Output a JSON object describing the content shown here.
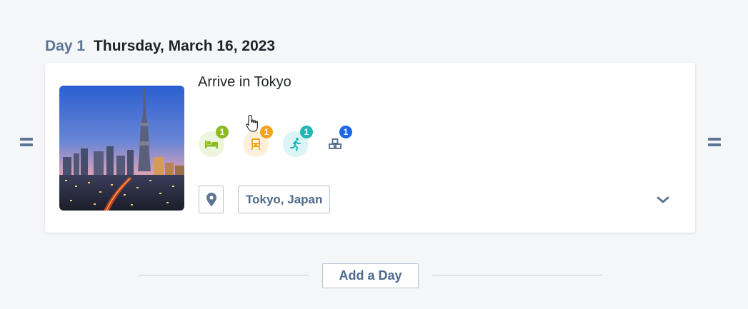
{
  "day": {
    "label": "Day 1",
    "date": "Thursday, March 16, 2023"
  },
  "card": {
    "title": "Arrive in Tokyo",
    "image_alt": "Tokyo skyline with Skytree tower at dusk",
    "categories": [
      {
        "name": "lodging",
        "icon": "bed-icon",
        "count": "1",
        "color": "#8cbb1f",
        "bg": "#eef5df"
      },
      {
        "name": "transit",
        "icon": "train-icon",
        "count": "1",
        "color": "#f5a31a",
        "bg": "#fdf0d9"
      },
      {
        "name": "activity",
        "icon": "running-icon",
        "count": "1",
        "color": "#1fb7b5",
        "bg": "#dcf4f4"
      },
      {
        "name": "other",
        "icon": "blocks-icon",
        "count": "1",
        "color": "#1e66e8",
        "bg": "#ffffff"
      }
    ],
    "location": "Tokyo, Japan"
  },
  "add_day_label": "Add a Day",
  "colors": {
    "accent": "#5b7596",
    "border": "#b8c3d1",
    "background": "#f5f6f8"
  }
}
